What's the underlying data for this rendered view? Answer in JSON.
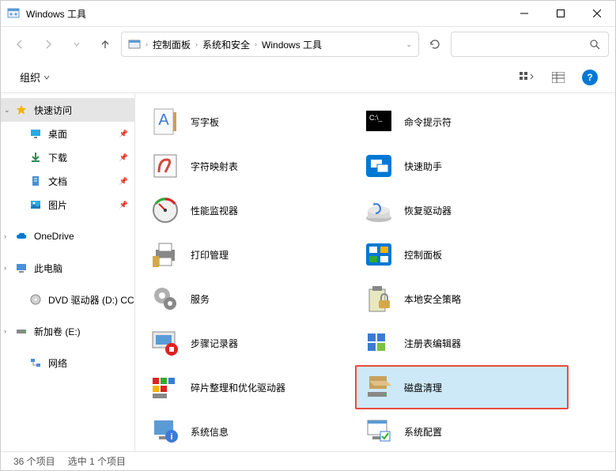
{
  "titlebar": {
    "title": "Windows 工具"
  },
  "breadcrumb": {
    "root": "控制面板",
    "mid": "系统和安全",
    "leaf": "Windows 工具"
  },
  "toolbar": {
    "organize": "组织"
  },
  "sidebar": {
    "quick": "快速访问",
    "desk": "桌面",
    "dl": "下载",
    "docs": "文档",
    "pics": "图片",
    "od": "OneDrive",
    "pc": "此电脑",
    "dvd": "DVD 驱动器 (D:) CC",
    "vol": "新加卷 (E:)",
    "net": "网络"
  },
  "items": {
    "wordpad": "写字板",
    "cmd": "命令提示符",
    "charmap": "字符映射表",
    "quickassist": "快速助手",
    "perfmon": "性能监视器",
    "recovery": "恢复驱动器",
    "printmgmt": "打印管理",
    "ctrlpanel": "控制面板",
    "services": "服务",
    "secpol": "本地安全策略",
    "psr": "步骤记录器",
    "regedit": "注册表编辑器",
    "defrag": "碎片整理和优化驱动器",
    "cleanmgr": "磁盘清理",
    "sysinfo": "系统信息",
    "msconfig": "系统配置"
  },
  "status": {
    "count": "36 个项目",
    "selected": "选中 1 个项目"
  }
}
